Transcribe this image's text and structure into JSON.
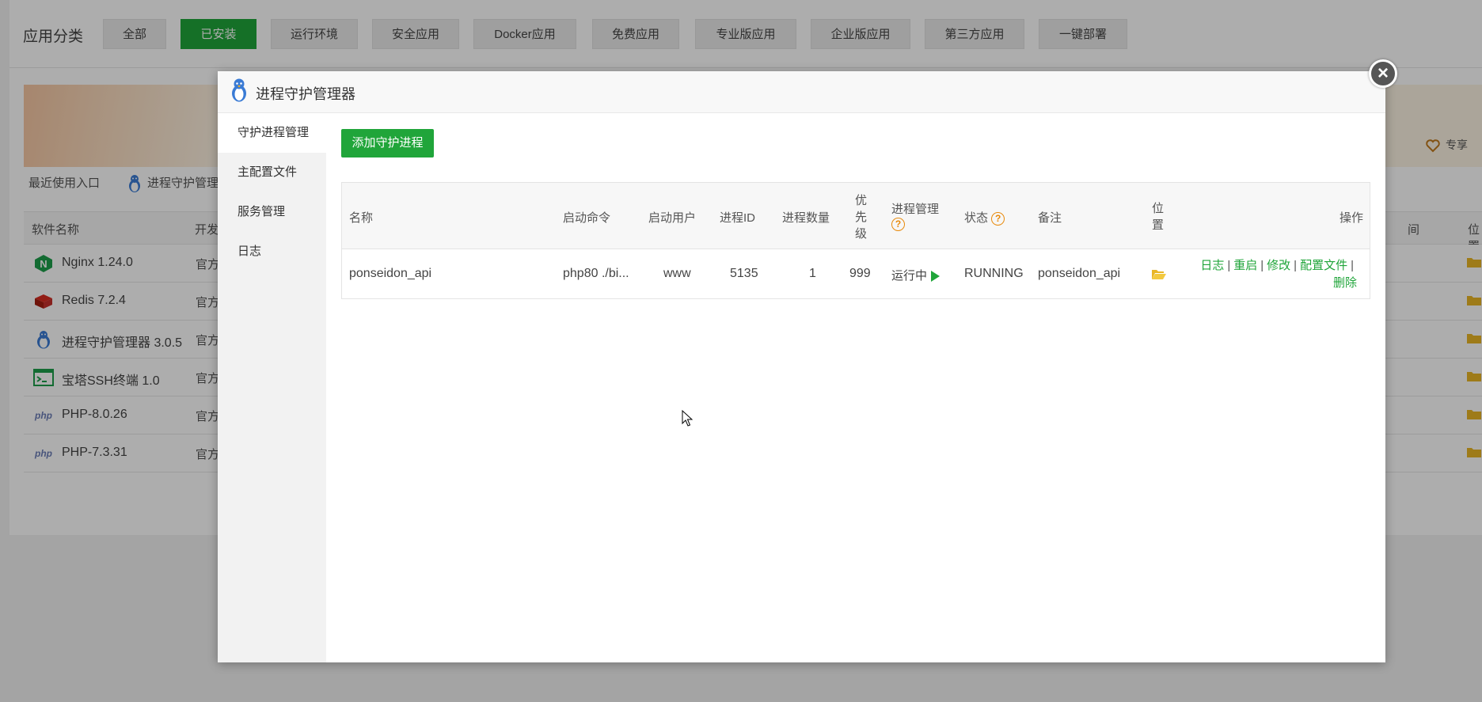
{
  "categories": {
    "title": "应用分类",
    "buttons": [
      {
        "label": "全部",
        "active": false
      },
      {
        "label": "已安装",
        "active": true
      },
      {
        "label": "运行环境",
        "active": false
      },
      {
        "label": "安全应用",
        "active": false
      },
      {
        "label": "Docker应用",
        "active": false
      },
      {
        "label": "免费应用",
        "active": false
      },
      {
        "label": "专业版应用",
        "active": false
      },
      {
        "label": "企业版应用",
        "active": false
      },
      {
        "label": "第三方应用",
        "active": false
      },
      {
        "label": "一键部署",
        "active": false
      }
    ]
  },
  "banner": {
    "right_text": "专享"
  },
  "recent": {
    "label": "最近使用入口",
    "item": "进程守护管理"
  },
  "software_table": {
    "headers": {
      "name": "软件名称",
      "developer": "开发",
      "time": "间",
      "location": "位置"
    },
    "rows": [
      {
        "name": "Nginx 1.24.0",
        "developer": "官方",
        "icon": "nginx-icon"
      },
      {
        "name": "Redis 7.2.4",
        "developer": "官方",
        "icon": "redis-icon"
      },
      {
        "name": "进程守护管理器 3.0.5",
        "developer": "官方",
        "icon": "tux-icon"
      },
      {
        "name": "宝塔SSH终端 1.0",
        "developer": "官方",
        "icon": "terminal-icon"
      },
      {
        "name": "PHP-8.0.26",
        "developer": "官方",
        "icon": "php-icon"
      },
      {
        "name": "PHP-7.3.31",
        "developer": "官方",
        "icon": "php-icon"
      }
    ]
  },
  "modal": {
    "title": "进程守护管理器",
    "close": "×",
    "side_menu": [
      {
        "label": "守护进程管理",
        "active": true
      },
      {
        "label": "主配置文件",
        "active": false
      },
      {
        "label": "服务管理",
        "active": false
      },
      {
        "label": "日志",
        "active": false
      }
    ],
    "add_button": "添加守护进程",
    "table": {
      "headers": {
        "name": "名称",
        "command": "启动命令",
        "user": "启动用户",
        "pid": "进程ID",
        "count": "进程数量",
        "priority": "优先级",
        "management": "进程管理",
        "status": "状态",
        "remark": "备注",
        "location": "位置",
        "operations": "操作"
      },
      "rows": [
        {
          "name": "ponseidon_api",
          "command": "php80 ./bi...",
          "user": "www",
          "pid": "5135",
          "count": "1",
          "priority": "999",
          "management": "运行中",
          "status": "RUNNING",
          "remark": "ponseidon_api",
          "ops": {
            "log": "日志",
            "restart": "重启",
            "edit": "修改",
            "config": "配置文件",
            "delete": "删除",
            "separator": "|"
          }
        }
      ]
    },
    "priority_lines": [
      "优",
      "先",
      "级"
    ],
    "location_lines": [
      "位",
      "置"
    ]
  },
  "colors": {
    "accent": "#20a53a",
    "warning": "#e88a0c"
  }
}
